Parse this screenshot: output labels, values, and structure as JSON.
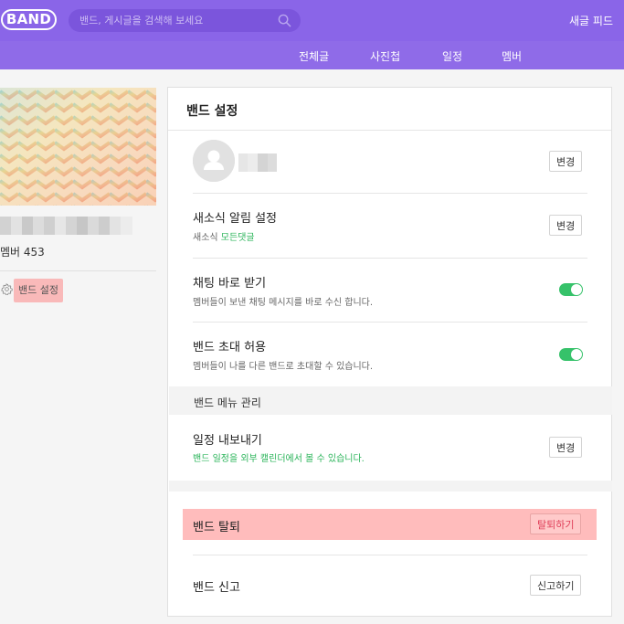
{
  "header": {
    "logo_text": "BAND",
    "search_placeholder": "밴드, 게시글을 검색해 보세요",
    "new_feed_label": "새글 피드"
  },
  "nav": {
    "tabs": [
      {
        "label": "전체글"
      },
      {
        "label": "사진첩"
      },
      {
        "label": "일정"
      },
      {
        "label": "멤버"
      }
    ]
  },
  "sidebar": {
    "member_count": "멤버 453",
    "settings_label": "밴드 설정"
  },
  "panel": {
    "title": "밴드 설정",
    "profile": {
      "change_label": "변경"
    },
    "notification": {
      "title": "새소식 알림 설정",
      "sub_prefix": "새소식",
      "sub_value": "모든댓글",
      "change_label": "변경"
    },
    "chat": {
      "title": "채팅 바로 받기",
      "description": "멤버들이 보낸 채팅 메시지를 바로 수신 합니다.",
      "enabled": true
    },
    "invite": {
      "title": "밴드 초대 허용",
      "description": "멤버들이 나를 다른 밴드로 초대할 수 있습니다.",
      "enabled": true
    },
    "menu_section_label": "밴드 메뉴 관리",
    "export": {
      "title": "일정 내보내기",
      "description": "밴드 일정을 외부 캘린더에서 볼 수 있습니다.",
      "change_label": "변경"
    },
    "leave": {
      "title": "밴드 탈퇴",
      "button_label": "탈퇴하기"
    },
    "report": {
      "title": "밴드 신고",
      "button_label": "신고하기"
    }
  },
  "colors": {
    "brand": "#8a65e8",
    "toggle_on": "#36c26a",
    "accent_green": "#2bb45a",
    "highlight": "#ffbcbc"
  }
}
